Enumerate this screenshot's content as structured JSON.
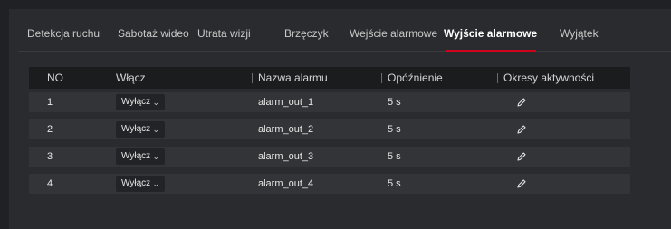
{
  "tabs": [
    {
      "label": "Detekcja ruchu"
    },
    {
      "label": "Sabotaż wideo"
    },
    {
      "label": "Utrata wizji"
    },
    {
      "label": "Brzęczyk"
    },
    {
      "label": "Wejście alarmowe"
    },
    {
      "label": "Wyjście alarmowe"
    },
    {
      "label": "Wyjątek"
    }
  ],
  "active_tab": "Wyjście alarmowe",
  "table": {
    "headers": {
      "no": "NO",
      "enable": "Włącz",
      "name": "Nazwa alarmu",
      "delay": "Opóźnienie",
      "schedule": "Okresy aktywności"
    },
    "rows": [
      {
        "no": "1",
        "enable": "Wyłącz",
        "name": "alarm_out_1",
        "delay": "5 s"
      },
      {
        "no": "2",
        "enable": "Wyłącz",
        "name": "alarm_out_2",
        "delay": "5 s"
      },
      {
        "no": "3",
        "enable": "Wyłącz",
        "name": "alarm_out_3",
        "delay": "5 s"
      },
      {
        "no": "4",
        "enable": "Wyłącz",
        "name": "alarm_out_4",
        "delay": "5 s"
      }
    ]
  },
  "colors": {
    "background": "#202124",
    "panel": "#2a2b2e",
    "header_row": "#1b1c1e",
    "row": "#333437",
    "accent": "#d0021b"
  },
  "icons": {
    "select_chevron": "chevron-down-icon",
    "schedule_edit": "pencil-icon"
  }
}
